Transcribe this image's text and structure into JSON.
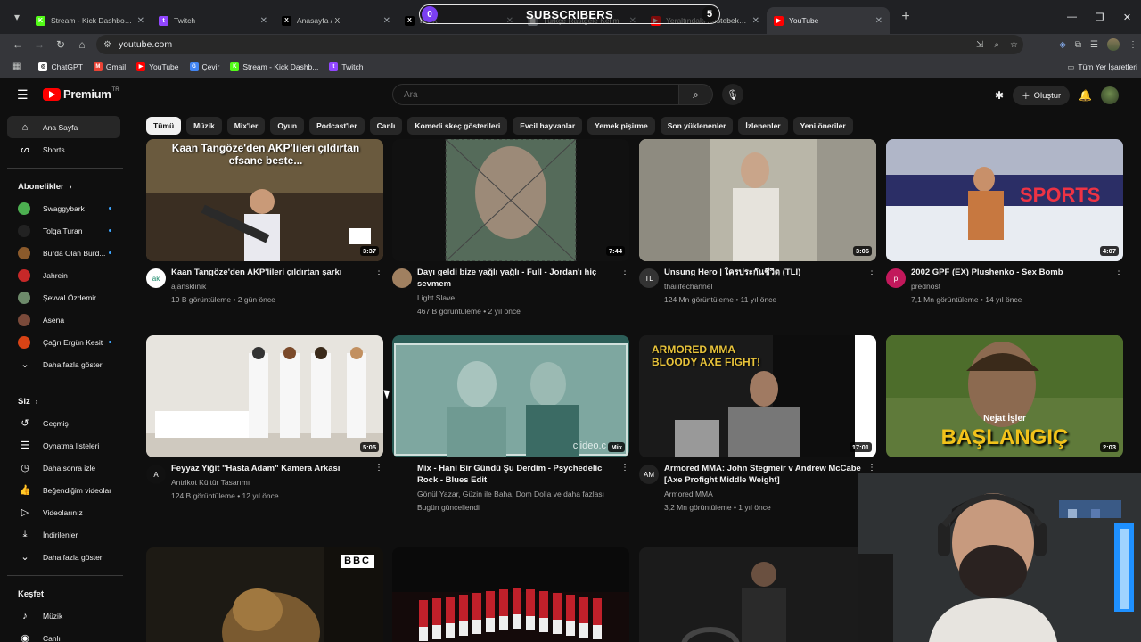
{
  "browser": {
    "tabs": [
      {
        "title": "Stream - Kick Dashboard",
        "fav_color": "#53fc18",
        "fav_text": "K",
        "active": false
      },
      {
        "title": "Twitch",
        "fav_color": "#9146ff",
        "fav_text": "t",
        "active": false
      },
      {
        "title": "Anasayfa / X",
        "fav_color": "#000000",
        "fav_text": "X",
        "active": false
      },
      {
        "title": "fa / X",
        "fav_color": "#000000",
        "fav_text": "X",
        "active": false
      },
      {
        "title": "Türkçe Rastgele Kelim",
        "fav_color": "#5f6368",
        "fav_text": "▦",
        "active": false
      },
      {
        "title": "Yeraltındaki Köstebek İnsa",
        "fav_color": "#ff0000",
        "fav_text": "▶",
        "active": false
      },
      {
        "title": "YouTube",
        "fav_color": "#ff0000",
        "fav_text": "▶",
        "active": true
      }
    ],
    "new_tab": "+",
    "window_controls": {
      "minimize": "—",
      "restore": "❐",
      "close": "✕"
    },
    "url": "youtube.com",
    "site_info": "⚙",
    "bookmarks": [
      {
        "label": "ChatGPT",
        "color": "#ffffff",
        "text": "◎"
      },
      {
        "label": "Gmail",
        "color": "#ea4335",
        "text": "M"
      },
      {
        "label": "YouTube",
        "color": "#ff0000",
        "text": "▶"
      },
      {
        "label": "Çevir",
        "color": "#4285f4",
        "text": "G"
      },
      {
        "label": "Stream - Kick Dashb...",
        "color": "#53fc18",
        "text": "K"
      },
      {
        "label": "Twitch",
        "color": "#9146ff",
        "text": "t"
      }
    ],
    "all_bookmarks": "Tüm Yer İşaretleri"
  },
  "overlay": {
    "label": "SUBSCRIBERS",
    "left_count": "0",
    "right_count": "5"
  },
  "youtube": {
    "logo_text": "Premium",
    "country": "TR",
    "search_placeholder": "Ara",
    "create_label": "Oluştur",
    "sidebar": {
      "main": [
        {
          "label": "Ana Sayfa",
          "icon": "home-icon",
          "glyph": "⌂",
          "selected": true
        },
        {
          "label": "Shorts",
          "icon": "shorts-icon",
          "glyph": "ᔕ",
          "selected": false
        }
      ],
      "subs_header": "Abonelikler",
      "subs": [
        {
          "label": "Swaggybark",
          "color": "#4caf50",
          "dot": true
        },
        {
          "label": "Tolga Turan",
          "color": "#222222",
          "dot": true
        },
        {
          "label": "Burda Olan Burd...",
          "color": "#8b5a2b",
          "dot": true
        },
        {
          "label": "Jahrein",
          "color": "#c62828",
          "dot": false
        },
        {
          "label": "Şevval Özdemir",
          "color": "#6d8a6a",
          "dot": false
        },
        {
          "label": "Asena",
          "color": "#7a4a3a",
          "dot": false
        },
        {
          "label": "Çağrı Ergün Kesit",
          "color": "#d84315",
          "dot": true
        }
      ],
      "subs_more": "Daha fazla göster",
      "you_header": "Siz",
      "you": [
        {
          "label": "Geçmiş",
          "icon": "history-icon",
          "glyph": "↺"
        },
        {
          "label": "Oynatma listeleri",
          "icon": "playlist-icon",
          "glyph": "☰"
        },
        {
          "label": "Daha sonra izle",
          "icon": "clock-icon",
          "glyph": "◷"
        },
        {
          "label": "Beğendiğim videolar",
          "icon": "like-icon",
          "glyph": "👍"
        },
        {
          "label": "Videolarınız",
          "icon": "video-icon",
          "glyph": "▷"
        },
        {
          "label": "İndirilenler",
          "icon": "download-icon",
          "glyph": "⤓"
        }
      ],
      "you_more": "Daha fazla göster",
      "explore_header": "Keşfet",
      "explore": [
        {
          "label": "Müzik",
          "icon": "music-icon",
          "glyph": "♪"
        },
        {
          "label": "Canlı",
          "icon": "live-icon",
          "glyph": "◉"
        }
      ]
    },
    "chips": [
      "Tümü",
      "Müzik",
      "Mix'ler",
      "Oyun",
      "Podcast'ler",
      "Canlı",
      "Komedi skeç gösterileri",
      "Evcil hayvanlar",
      "Yemek pişirme",
      "Son yüklenenler",
      "İzlenenler",
      "Yeni öneriler"
    ],
    "videos": [
      {
        "title": "Kaan Tangöze'den AKP'lileri çıldırtan şarkı",
        "channel": "ajansklinik",
        "stats": "19 B görüntüleme • 2 gün önce",
        "duration": "3:37",
        "thumb_text": "Kaan Tangöze'den AKP'lileri çıldırtan efsane beste...",
        "avatar_color": "#ffffff",
        "avatar_text": "ak"
      },
      {
        "title": "Dayı geldi bize yağlı yağlı - Full - Jordan'ı hiç sevmem",
        "channel": "Light Slave",
        "stats": "467 B görüntüleme • 2 yıl önce",
        "duration": "7:44",
        "thumb_text": "",
        "avatar_color": "#a08060",
        "avatar_text": ""
      },
      {
        "title": "Unsung Hero | ใครประกันชีวิต (TLI)",
        "channel": "thailifechannel",
        "stats": "124 Mn görüntüleme • 11 yıl önce",
        "duration": "3:06",
        "thumb_text": "",
        "avatar_color": "#333333",
        "avatar_text": "TL"
      },
      {
        "title": "2002 GPF (EX) Plushenko - Sex Bomb",
        "channel": "prednost",
        "stats": "7,1 Mn görüntüleme • 14 yıl önce",
        "duration": "4:07",
        "thumb_text": "SPORTS",
        "avatar_color": "#c2185b",
        "avatar_text": "p"
      },
      {
        "title": "Feyyaz Yiğit \"Hasta Adam\" Kamera Arkası",
        "channel": "Antrikot Kültür Tasarımı",
        "stats": "124 B görüntüleme • 12 yıl önce",
        "duration": "5:05",
        "thumb_text": "",
        "avatar_color": "#111111",
        "avatar_text": "A"
      },
      {
        "title": "Mix - Hani Bir Gündü Şu Derdim - Psychedelic Rock - Blues Edit",
        "channel": "Gönül Yazar, Güzin ile Baha, Dom Dolla ve daha fazlası",
        "stats": "Bugün güncellendi",
        "duration": "Mix",
        "thumb_text": "clideo.c",
        "avatar_color": "",
        "avatar_text": ""
      },
      {
        "title": "Armored MMA: John Stegmeir v Andrew McCabe [Axe Profight Middle Weight]",
        "channel": "Armored MMA",
        "stats": "3,2 Mn görüntüleme • 1 yıl önce",
        "duration": "17:01",
        "thumb_text": "ARMORED MMA  BLOODY AXE FIGHT!",
        "avatar_color": "#222222",
        "avatar_text": "AM"
      },
      {
        "title": "",
        "channel": "",
        "stats": "",
        "duration": "2:03",
        "thumb_text": "BAŞLANGIÇ",
        "thumb_sub": "Nejat İşler",
        "avatar_color": "",
        "avatar_text": ""
      },
      {
        "title": "",
        "channel": "",
        "stats": "",
        "duration": "",
        "thumb_text": "BBC",
        "avatar_color": "",
        "avatar_text": ""
      },
      {
        "title": "",
        "channel": "",
        "stats": "",
        "duration": "",
        "thumb_text": "",
        "avatar_color": "",
        "avatar_text": ""
      },
      {
        "title": "",
        "channel": "",
        "stats": "",
        "duration": "",
        "thumb_text": "",
        "avatar_color": "",
        "avatar_text": ""
      }
    ]
  }
}
